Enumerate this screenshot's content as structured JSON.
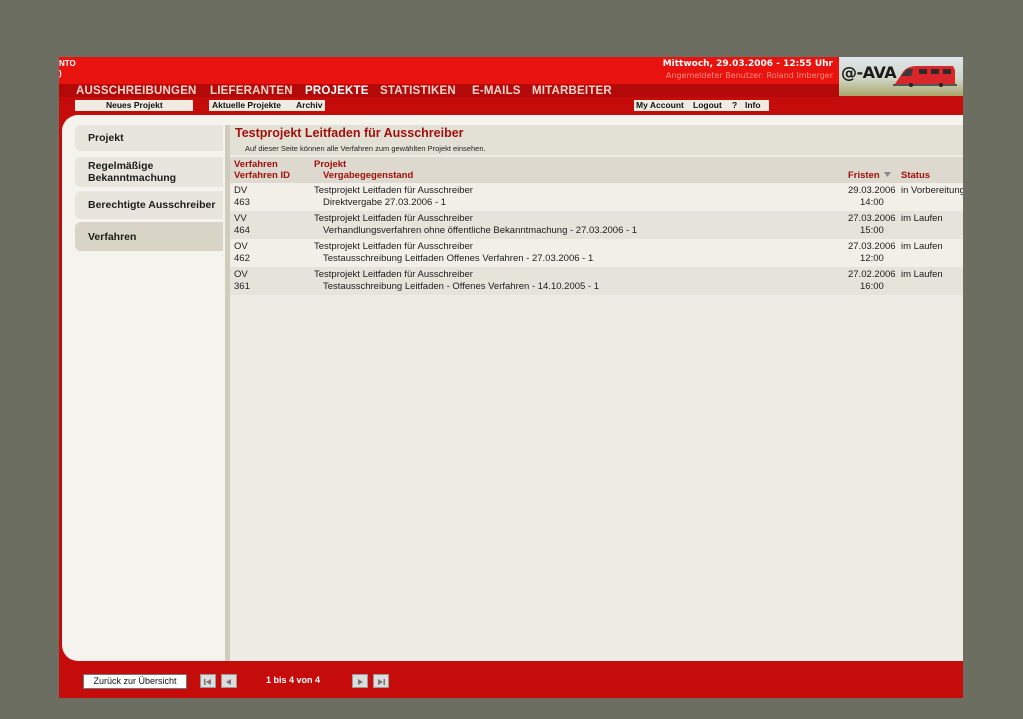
{
  "header": {
    "left_fragments": [
      "NTO",
      ")"
    ],
    "date_time": "Mittwoch, 29.03.2006 - 12:55 Uhr",
    "user": "Angemeldeter Benutzer: Roland Imberger",
    "logo_text": "@-AVA"
  },
  "main_nav": [
    {
      "label": "AUSSCHREIBUNGEN",
      "active": false
    },
    {
      "label": "LIEFERANTEN",
      "active": false
    },
    {
      "label": "PROJEKTE",
      "active": true
    },
    {
      "label": "STATISTIKEN",
      "active": false
    },
    {
      "label": "E-MAILS",
      "active": false
    },
    {
      "label": "MITARBEITER",
      "active": false
    }
  ],
  "sub_nav": {
    "new_project": "Neues Projekt",
    "current_projects": "Aktuelle Projekte",
    "archive": "Archiv",
    "my_account": "My Account",
    "logout": "Logout",
    "help": "?",
    "info": "Info"
  },
  "sidebar": {
    "items": [
      {
        "label": "Projekt",
        "active": false
      },
      {
        "label": "Regelmäßige Bekanntmachung",
        "active": false
      },
      {
        "label": "Berechtigte Ausschreiber",
        "active": false
      },
      {
        "label": "Verfahren",
        "active": true
      }
    ]
  },
  "content": {
    "title": "Testprojekt Leitfaden für Ausschreiber",
    "subtitle": "Auf dieser Seite können alle Verfahren zum gewählten Projekt einsehen."
  },
  "table": {
    "headers": {
      "verfahren": "Verfahren",
      "verfahren_id": "Verfahren ID",
      "projekt": "Projekt",
      "vergabegegenstand": "Vergabegegenstand",
      "fristen": "Fristen",
      "status": "Status"
    },
    "rows": [
      {
        "verfahren": "DV",
        "id": "463",
        "projekt": "Testprojekt Leitfaden für Ausschreiber",
        "gegenstand": "Direktvergabe 27.03.2006 - 1",
        "frist_datum": "29.03.2006",
        "frist_zeit": "14:00",
        "status": "in Vorbereitung"
      },
      {
        "verfahren": "VV",
        "id": "464",
        "projekt": "Testprojekt Leitfaden für Ausschreiber",
        "gegenstand": "Verhandlungsverfahren ohne öffentliche Bekanntmachung - 27.03.2006 - 1",
        "frist_datum": "27.03.2006",
        "frist_zeit": "15:00",
        "status": "im Laufen"
      },
      {
        "verfahren": "OV",
        "id": "462",
        "projekt": "Testprojekt Leitfaden für Ausschreiber",
        "gegenstand": "Testausschreibung Leitfaden Offenes Verfahren - 27.03.2006 - 1",
        "frist_datum": "27.03.2006",
        "frist_zeit": "12:00",
        "status": "im Laufen"
      },
      {
        "verfahren": "OV",
        "id": "361",
        "projekt": "Testprojekt Leitfaden für Ausschreiber",
        "gegenstand": "Testausschreibung Leitfaden - Offenes Verfahren - 14.10.2005 - 1",
        "frist_datum": "27.02.2006",
        "frist_zeit": "16:00",
        "status": "im Laufen"
      }
    ]
  },
  "footer": {
    "back_button": "Zurück zur Übersicht",
    "pagination_text": "1 bis 4 von 4"
  },
  "colors": {
    "brand_red": "#e8120f",
    "frame_red": "#c60b0b",
    "heading_red": "#a1100d",
    "panel_bg": "#f4f3ee"
  }
}
